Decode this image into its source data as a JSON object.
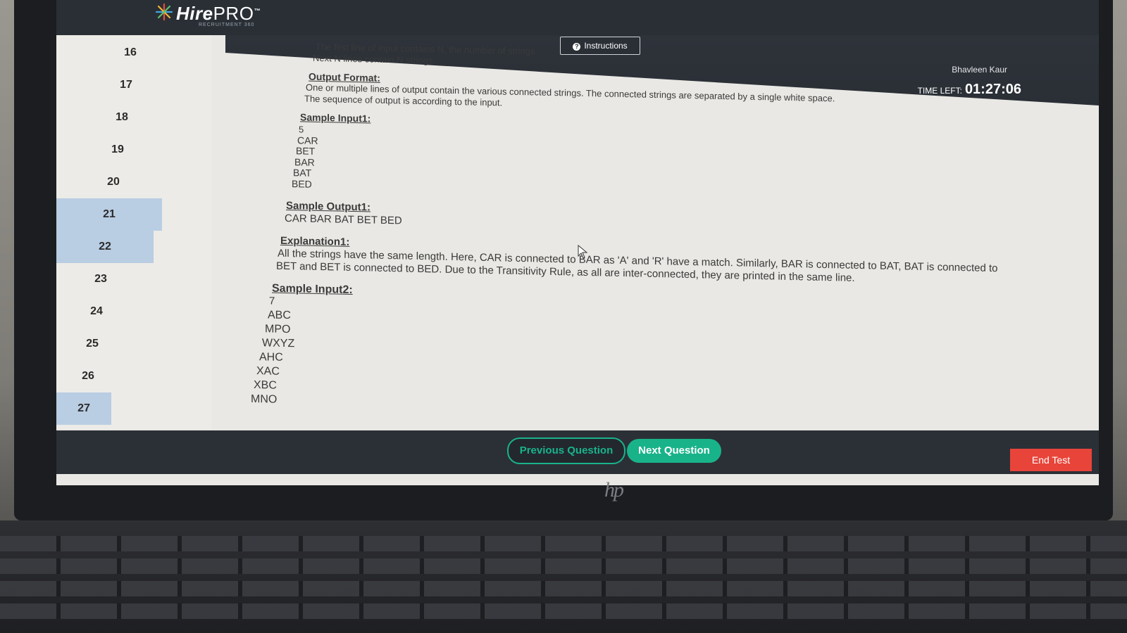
{
  "app": {
    "logo_text": "Hire",
    "logo_text_2": "PRO",
    "logo_tm": "™",
    "logo_sub": "RECRUITMENT 360"
  },
  "header": {
    "instructions_label": "Instructions",
    "user_name": "Bhavleen Kaur",
    "time_left_label": "TIME LEFT:",
    "timer": "01:27:06"
  },
  "question_nav": {
    "items": [
      {
        "label": "16",
        "active": false
      },
      {
        "label": "17",
        "active": false
      },
      {
        "label": "18",
        "active": false
      },
      {
        "label": "19",
        "active": false
      },
      {
        "label": "20",
        "active": false
      },
      {
        "label": "21",
        "active": true
      },
      {
        "label": "22",
        "active": true
      },
      {
        "label": "23",
        "active": false
      },
      {
        "label": "24",
        "active": false
      },
      {
        "label": "25",
        "active": false
      },
      {
        "label": "26",
        "active": false
      },
      {
        "label": "27",
        "active": true
      }
    ]
  },
  "question": {
    "input_line_1": "The first line of input contains N, the number of strings.",
    "input_line_2": "Next N lines contain N strings.",
    "output_format_heading": "Output Format:",
    "output_line_1": "One or multiple lines of output contain the various connected strings. The connected strings are separated by a single white space.",
    "output_line_2": "The sequence of output is according to the input.",
    "sample_input1_heading": "Sample Input1:",
    "sample_input1": [
      "5",
      "CAR",
      "BET",
      "BAR",
      "BAT",
      "BED"
    ],
    "sample_output1_heading": "Sample Output1:",
    "sample_output1": "CAR BAR BAT BET BED",
    "explanation1_heading": "Explanation1:",
    "explanation1_line_1": "All the strings have the same length. Here, CAR is connected to BAR as 'A' and 'R' have a match. Similarly, BAR is connected to BAT, BAT is connected to",
    "explanation1_line_2": "BET and BET is connected to BED. Due to the Transitivity Rule, as all are inter-connected, they are printed in the same line.",
    "sample_input2_heading": "Sample Input2:",
    "sample_input2": [
      "7",
      "ABC",
      "MPO",
      "WXYZ",
      "AHC",
      "XAC",
      "XBC",
      "MNO"
    ]
  },
  "footer": {
    "prev_label": "Previous Question",
    "next_label": "Next Question",
    "end_label": "End Test"
  },
  "device": {
    "brand_mark": "hp"
  },
  "colors": {
    "header_bg": "#2a2f36",
    "accent_green": "#19b38a",
    "end_red": "#e8443a",
    "active_question": "#b9cde3"
  }
}
